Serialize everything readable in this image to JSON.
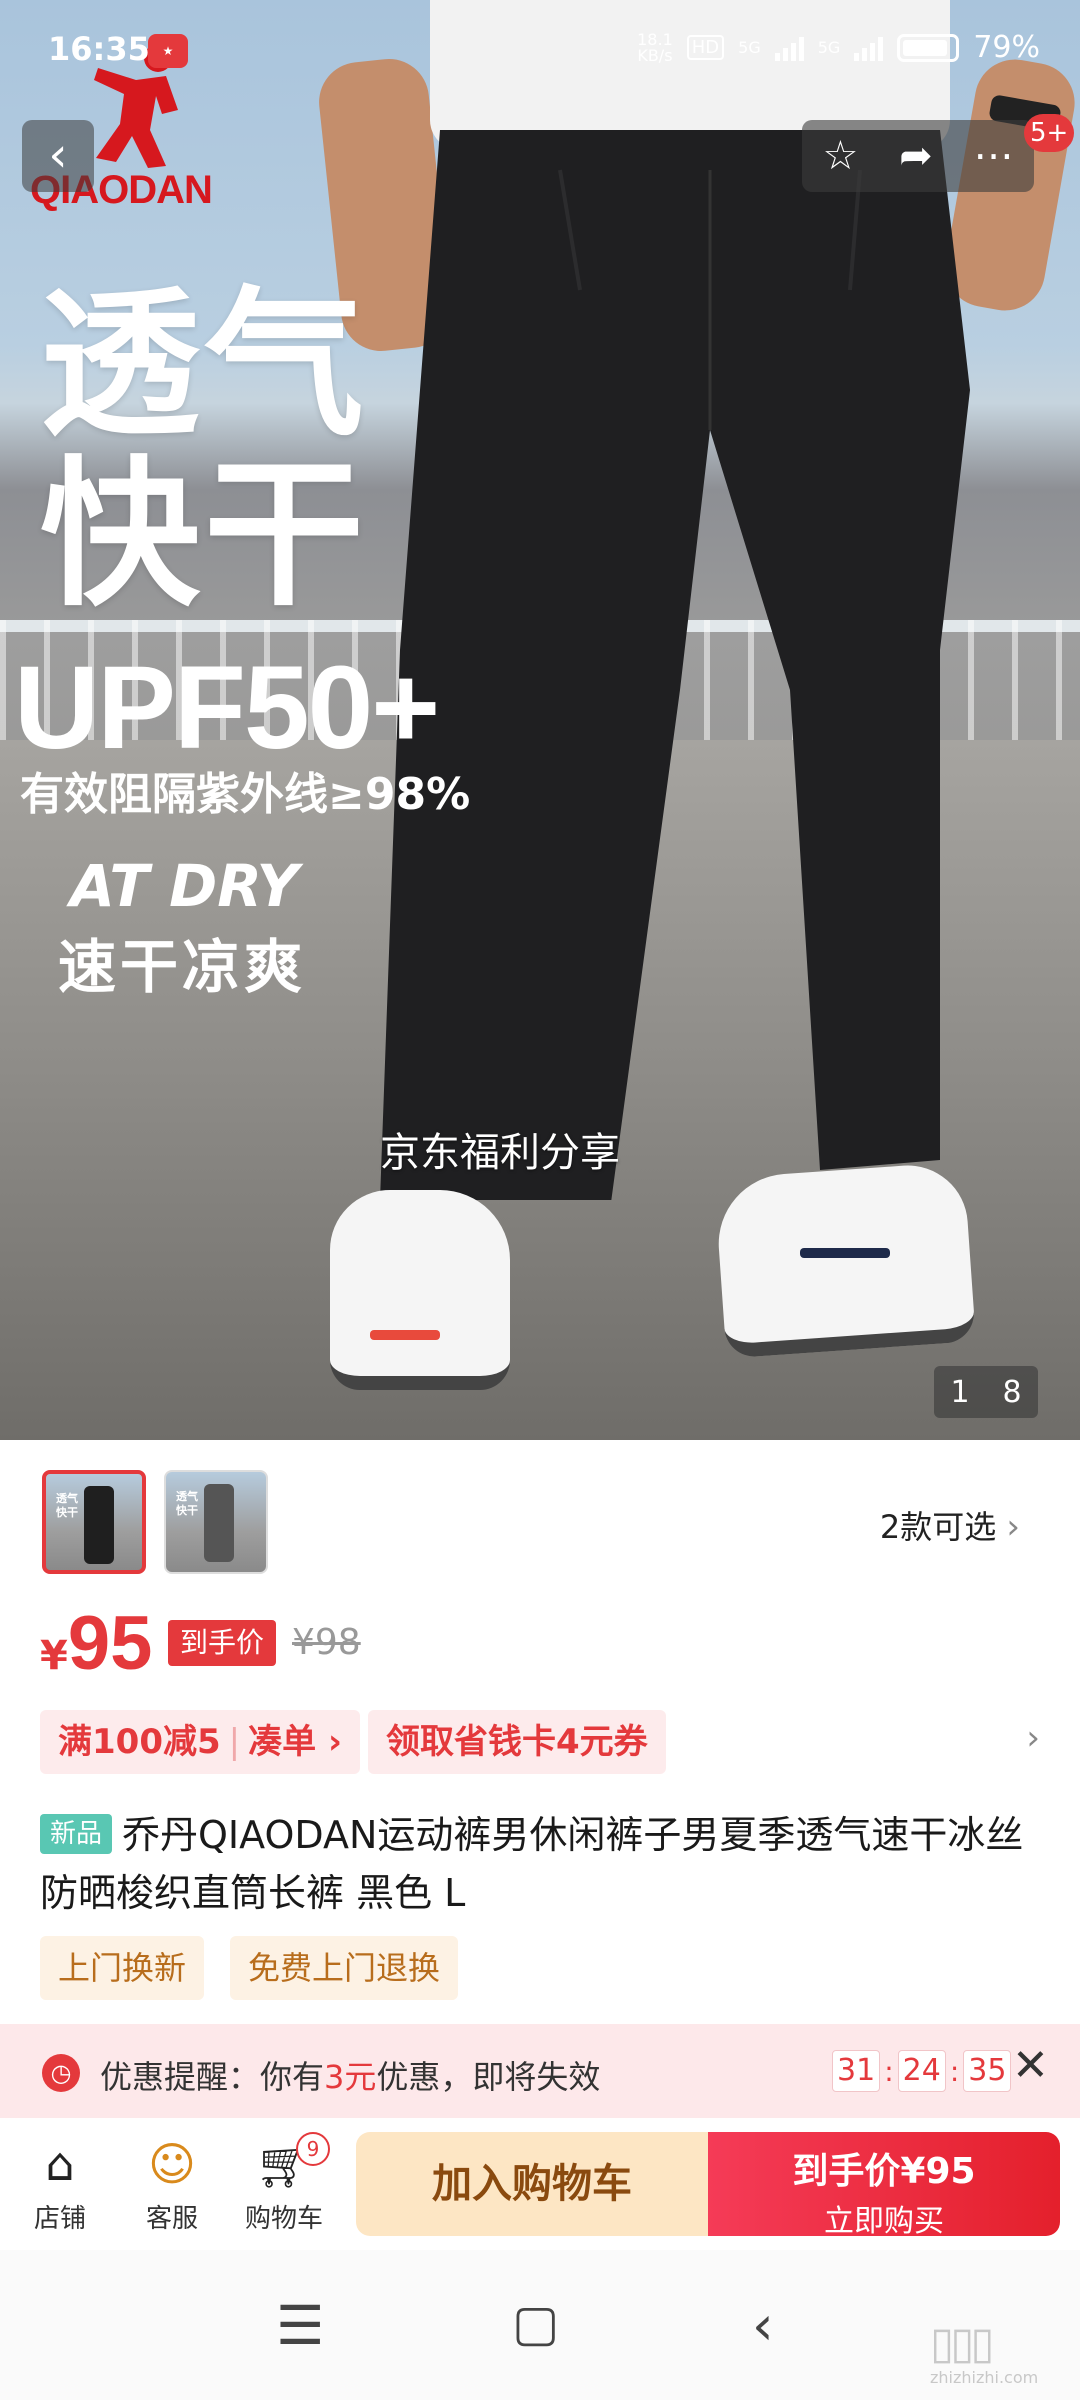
{
  "status_bar": {
    "time": "16:35",
    "net_speed": "18.1\nKB/s",
    "hd": "HD",
    "sim1": "5G",
    "sim2": "5G",
    "battery": "79%"
  },
  "hero": {
    "brand_logo": "QIAODAN",
    "slogan_line1": "透气",
    "slogan_line2": "快干",
    "upf": "UPF50+",
    "upf_sub": "有效阻隔紫外线≥98%",
    "atdry": "AT DRY",
    "atdry_sub": "速干凉爽",
    "watermark": "京东福利分享",
    "pager_current": "1",
    "pager_total": "8",
    "cart_badge": "5+"
  },
  "product": {
    "styles_count_label": "2款可选",
    "price_symbol": "¥",
    "price": "95",
    "price_tag": "到手价",
    "original_price": "¥98",
    "coupon1_a": "满100减5",
    "coupon1_b": "凑单",
    "coupon2": "领取省钱卡4元券",
    "new_tag": "新品",
    "title": "乔丹QIAODAN运动裤男休闲裤子男夏季透气速干冰丝防晒梭织直筒长裤 黑色 L",
    "service1": "上门换新",
    "service2": "免费上门退换"
  },
  "alert": {
    "text_a": "优惠提醒：你有",
    "text_hl": "3元",
    "text_b": "优惠，即将失效",
    "hh": "31",
    "mm": "24",
    "ss": "35"
  },
  "bottom_bar": {
    "shop": "店铺",
    "service": "客服",
    "cart": "购物车",
    "cart_count": "9",
    "add_cart": "加入购物车",
    "buy_line1": "到手价¥95",
    "buy_line2": "立即购买"
  },
  "corner_mark": "zhizhizhi.com",
  "colors": {
    "accent": "#e4393c",
    "coupon_bg": "#fdebec",
    "service_bg": "#fdf2e4",
    "add_cart_bg": "#fde6c4"
  }
}
